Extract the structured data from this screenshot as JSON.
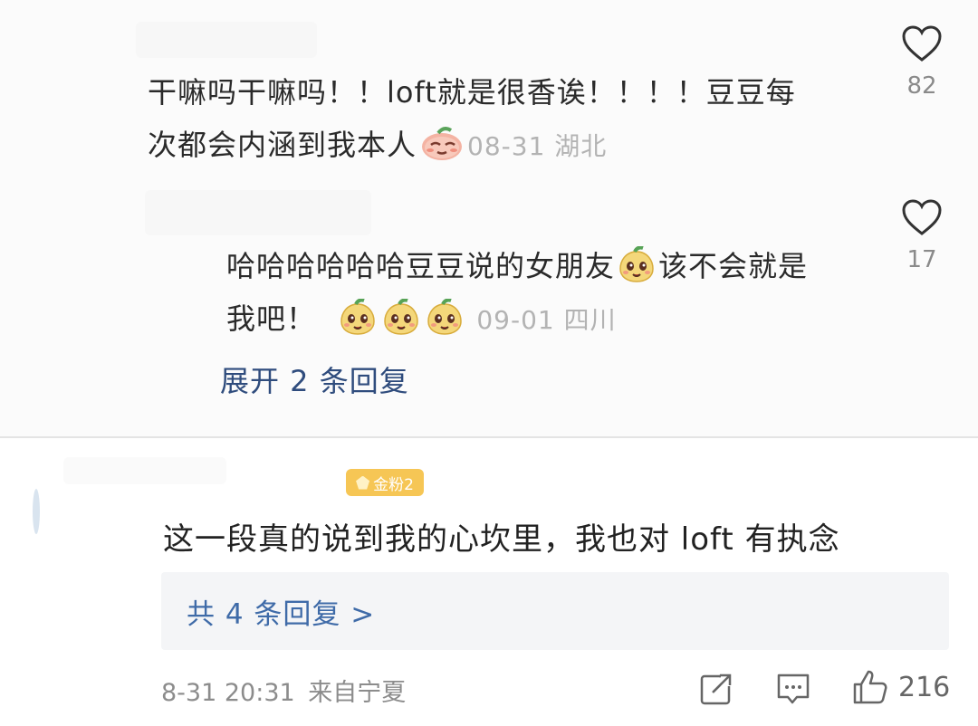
{
  "comments": [
    {
      "text_1": "干嘛吗干嘛吗！！loft就是很香诶！！！！豆豆每",
      "text_2": "次都会内涵到我本人",
      "meta": "08-31 湖北",
      "likes": "82",
      "emoji": "blushing-peach-emoji",
      "replies": [
        {
          "text_1a": "哈哈哈哈哈哈豆豆说的女朋友",
          "text_1b": "该不会就是",
          "text_2": "我吧！",
          "meta": "09-01 四川",
          "likes": "17"
        }
      ],
      "expand_label": "展开 2 条回复"
    }
  ],
  "weibo": {
    "badge": "金粉2",
    "text": "这一段真的说到我的心坎里，我也对 loft 有执念",
    "reply_link": "共 4 条回复 >",
    "timestamp": "8-31 20:31",
    "source": "来自宁夏",
    "like_count": "216"
  },
  "colors": {
    "link": "#3f6ba8",
    "expand": "#2f4c7d",
    "meta": "#b3b3b3",
    "badge": "#f6c655"
  }
}
